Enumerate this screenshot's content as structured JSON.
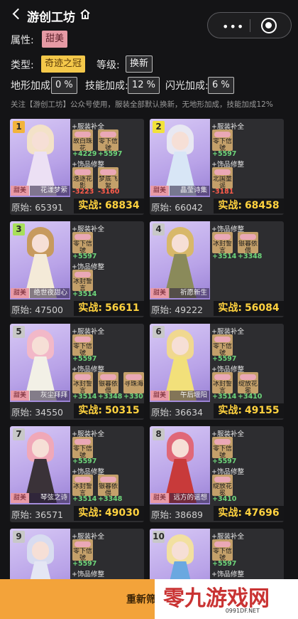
{
  "header": {
    "title": "游创工坊"
  },
  "capsule": {
    "dots": "•••"
  },
  "filters": {
    "attribute_label": "属性:",
    "attribute_value": "甜美",
    "type_label": "类型:",
    "type_value": "奇迹之冠",
    "level_label": "等级:",
    "level_value": "换新",
    "terrain_label": "地形加成:",
    "terrain_value": "0 %",
    "skill_label": "技能加成:",
    "skill_value": "12 %",
    "flash_label": "闪光加成:",
    "flash_value": "6 %"
  },
  "note": "关注【游创工坊】公众号使用，服装全部默认换新，无地形加成，技能加成12%",
  "labels": {
    "clothing": "+服装补全",
    "accessory": "+饰品修整",
    "original": "原始:",
    "actual": "实战:"
  },
  "cards": [
    {
      "rank": "1",
      "tag": "甜美",
      "name": "花漾梦萦",
      "rank_color": "#f2b43c",
      "clothing_items": [
        {
          "name": "故白珠花",
          "delta": "+4229"
        },
        {
          "name": "零下信號",
          "delta": "+5597"
        }
      ],
      "accessory_items": [
        {
          "name": "逸逐花影",
          "delta": "-3223"
        },
        {
          "name": "梦底飞絮",
          "delta": "-3160"
        }
      ],
      "original": "65391",
      "actual": "68834"
    },
    {
      "rank": "2",
      "tag": "甜美",
      "name": "晶莹诗集",
      "rank_color": "#f2e23c",
      "clothing_items": [
        {
          "name": "零下信號",
          "delta": "+5597"
        }
      ],
      "accessory_items": [
        {
          "name": "北国童谣",
          "delta": "-3181"
        }
      ],
      "original": "66042",
      "actual": "68458"
    },
    {
      "rank": "3",
      "tag": "甜美",
      "name": "绝世夜甜心",
      "rank_color": "#a8e05a",
      "clothing_items": [
        {
          "name": "零下信號",
          "delta": "+5597"
        }
      ],
      "accessory_items": [
        {
          "name": "冰封誓言",
          "delta": "+3514"
        }
      ],
      "original": "47500",
      "actual": "56611"
    },
    {
      "rank": "4",
      "tag": "甜美",
      "name": "祈愿新生",
      "rank_color": "#c8c8c8",
      "clothing_items": [],
      "accessory_items": [
        {
          "name": "冰封誓言",
          "delta": "+3514"
        },
        {
          "name": "银暮依偎",
          "delta": "+3348"
        }
      ],
      "original": "49222",
      "actual": "56084"
    },
    {
      "rank": "5",
      "tag": "甜美",
      "name": "灰尘拜拜",
      "rank_color": "#c8c8c8",
      "clothing_items": [
        {
          "name": "零下信號",
          "delta": "+5597"
        }
      ],
      "accessory_items": [
        {
          "name": "冰封誓言",
          "delta": "+3514"
        },
        {
          "name": "银暮依偎",
          "delta": "+3348"
        },
        {
          "name": "寻珠海",
          "delta": "+330"
        }
      ],
      "original": "34550",
      "actual": "50315"
    },
    {
      "rank": "6",
      "tag": "甜美",
      "name": "午后堰阳",
      "rank_color": "#c8c8c8",
      "clothing_items": [
        {
          "name": "零下信號",
          "delta": "+5597"
        }
      ],
      "accessory_items": [
        {
          "name": "冰封誓言",
          "delta": "+3514"
        },
        {
          "name": "绽放花冕",
          "delta": "+3410"
        }
      ],
      "original": "36634",
      "actual": "49155"
    },
    {
      "rank": "7",
      "tag": "甜美",
      "name": "琴弦之诗",
      "rank_color": "#c8c8c8",
      "clothing_items": [
        {
          "name": "零下信號",
          "delta": "+5597"
        }
      ],
      "accessory_items": [
        {
          "name": "冰封誓言",
          "delta": "+3514"
        },
        {
          "name": "银暮依偎",
          "delta": "+3348"
        }
      ],
      "original": "36571",
      "actual": "49030"
    },
    {
      "rank": "8",
      "tag": "甜美",
      "name": "远方的谣想",
      "rank_color": "#c8c8c8",
      "clothing_items": [
        {
          "name": "零下信號",
          "delta": "+5597"
        }
      ],
      "accessory_items": [
        {
          "name": "绽放花冕",
          "delta": "+3410"
        }
      ],
      "original": "38689",
      "actual": "47696"
    },
    {
      "rank": "9",
      "tag": "",
      "name": "",
      "rank_color": "#c8c8c8",
      "clothing_items": [
        {
          "name": "零下信號",
          "delta": "+5597"
        }
      ],
      "accessory_items": [],
      "original": "",
      "actual": ""
    },
    {
      "rank": "10",
      "tag": "",
      "name": "",
      "rank_color": "#c8c8c8",
      "clothing_items": [
        {
          "name": "零下信號",
          "delta": "+5597"
        }
      ],
      "accessory_items": [],
      "original": "",
      "actual": ""
    }
  ],
  "bottom": {
    "button_text": "重新筛"
  },
  "watermark": {
    "text": "零九游戏网",
    "url": "0991DF.NET"
  },
  "colors": {
    "background": "#141416",
    "card": "#2d2d30",
    "gold_value": "#ffd23f",
    "positive": "#6ed67a",
    "negative": "#ff5c4a",
    "bottom_bar": "#f3a33a"
  }
}
